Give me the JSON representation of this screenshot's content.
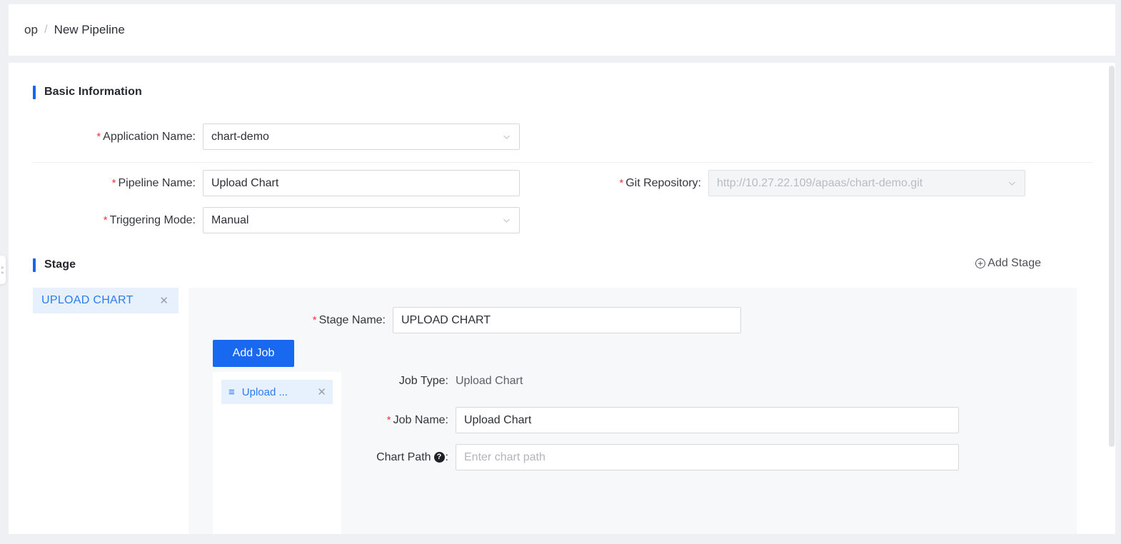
{
  "breadcrumb": {
    "root": "op",
    "separator": "/",
    "current": "New Pipeline"
  },
  "basic_information": {
    "title": "Basic Information",
    "fields": {
      "application_name": {
        "label": "Application Name:",
        "required_mark": "*",
        "value": "chart-demo",
        "control": "select",
        "icon": "chevron-down-icon"
      },
      "pipeline_name": {
        "label": "Pipeline Name:",
        "required_mark": "*",
        "value": "Upload Chart",
        "control": "text"
      },
      "triggering_mode": {
        "label": "Triggering Mode:",
        "required_mark": "*",
        "value": "Manual",
        "control": "select",
        "icon": "chevron-down-icon"
      },
      "git_repository": {
        "label": "Git Repository:",
        "required_mark": "*",
        "value": "http://10.27.22.109/apaas/chart-demo.git",
        "control": "select",
        "disabled": true,
        "icon": "chevron-down-icon"
      }
    }
  },
  "stage_section": {
    "title": "Stage",
    "add_stage_label": "Add  Stage",
    "add_stage_icon": "circle-plus-icon",
    "tabs": [
      {
        "label": "UPLOAD CHART",
        "active": true,
        "close_icon": "close-icon"
      }
    ],
    "detail": {
      "stage_name": {
        "label": "Stage Name:",
        "required_mark": "*",
        "value": "UPLOAD CHART"
      },
      "add_job_label": "Add Job",
      "jobs": [
        {
          "label": "Upload ...",
          "drag_icon": "drag-handle-icon",
          "close_icon": "close-icon",
          "active": true
        }
      ],
      "job_detail": {
        "job_type": {
          "label": "Job Type:",
          "value": "Upload Chart"
        },
        "job_name": {
          "label": "Job Name:",
          "required_mark": "*",
          "value": "Upload Chart"
        },
        "chart_path": {
          "label": "Chart Path",
          "help_icon": "help-circle-icon",
          "colon": ":",
          "placeholder": "Enter chart path",
          "value": ""
        }
      }
    }
  },
  "chrome": {
    "drawer_handle_icon": "collapse-handle-icon",
    "scrollbar": "vertical-scrollbar"
  },
  "colors": {
    "accent": "#1868f0",
    "accent_text": "#2a7bf0",
    "required": "#e8363c",
    "tab_active_bg": "#e6f1fd",
    "panel_bg": "#f7f8fa",
    "page_bg": "#eef0f4"
  }
}
